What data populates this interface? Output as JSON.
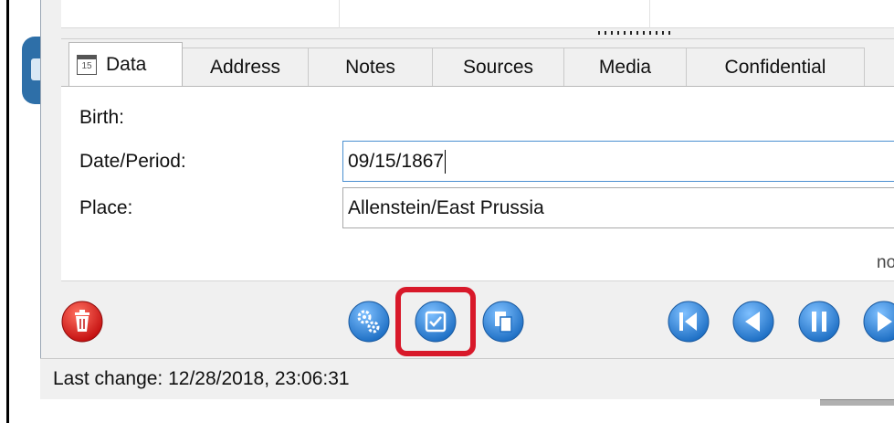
{
  "tabs": [
    {
      "label": "Data",
      "active": true,
      "icon": "calendar-icon"
    },
    {
      "label": "Address"
    },
    {
      "label": "Notes"
    },
    {
      "label": "Sources"
    },
    {
      "label": "Media"
    },
    {
      "label": "Confidential"
    }
  ],
  "calendar_icon_text": "15",
  "form": {
    "section_label": "Birth:",
    "date_label": "Date/Period:",
    "date_value": "09/15/1867",
    "place_label": "Place:",
    "place_value": "Allenstein/East Prussia",
    "clipped_text": "no"
  },
  "toolbar": {
    "buttons": [
      {
        "name": "delete-button",
        "icon": "trash-icon",
        "color": "#e02020"
      },
      {
        "name": "settings-button",
        "icon": "gears-icon",
        "color": "#2a7fd4"
      },
      {
        "name": "accept-button",
        "icon": "checkbox-icon",
        "color": "#2a7fd4",
        "highlighted": true
      },
      {
        "name": "copy-button",
        "icon": "copy-icon",
        "color": "#2a7fd4"
      },
      {
        "name": "first-record-button",
        "icon": "skip-first-icon",
        "color": "#2a7fd4"
      },
      {
        "name": "previous-record-button",
        "icon": "triangle-left-icon",
        "color": "#2a7fd4"
      },
      {
        "name": "pause-button",
        "icon": "pause-icon",
        "color": "#2a7fd4"
      },
      {
        "name": "next-record-button",
        "icon": "triangle-right-icon",
        "color": "#2a7fd4"
      }
    ]
  },
  "status": {
    "last_change": "Last change: 12/28/2018, 23:06:31"
  }
}
